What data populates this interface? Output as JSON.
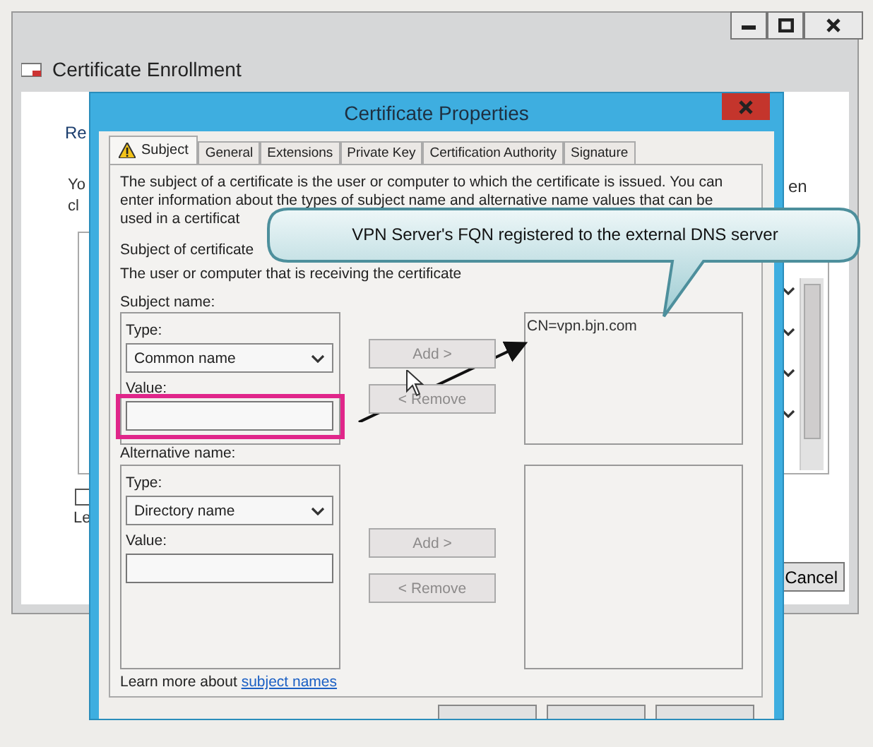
{
  "background_window": {
    "title": "Certificate Enrollment",
    "heading": "Re",
    "text_lines": [
      "Yo",
      "cl"
    ],
    "text_right": "en",
    "checkbox": {
      "label": "Le",
      "checked": false
    },
    "cancel_button": "Cancel"
  },
  "dialog": {
    "title": "Certificate Properties",
    "tabs": [
      {
        "label": "Subject",
        "selected": true,
        "warning": true
      },
      {
        "label": "General",
        "selected": false,
        "warning": false
      },
      {
        "label": "Extensions",
        "selected": false,
        "warning": false
      },
      {
        "label": "Private Key",
        "selected": false,
        "warning": false
      },
      {
        "label": "Certification Authority",
        "selected": false,
        "warning": false
      },
      {
        "label": "Signature",
        "selected": false,
        "warning": false
      }
    ],
    "description": "The subject of a certificate is the user or computer to which the certificate is issued. You can enter information about the types of subject name and alternative name values that can be used in a certificat",
    "section_title": "Subject of certificate",
    "section_hint": "The user or computer that is receiving the certificate",
    "groups": [
      {
        "label": "Subject name:",
        "type_label": "Type:",
        "type_value": "Common name",
        "value_label": "Value:",
        "highlighted": true,
        "add_button": {
          "label": "Add >",
          "disabled": true
        },
        "remove_button": {
          "label": "< Remove",
          "disabled": true
        },
        "entries": [
          "CN=vpn.bjn.com"
        ]
      },
      {
        "label": "Alternative name:",
        "type_label": "Type:",
        "type_value": "Directory name",
        "value_label": "Value:",
        "highlighted": false,
        "add_button": {
          "label": "Add >",
          "disabled": true
        },
        "remove_button": {
          "label": "< Remove",
          "disabled": true
        }
      }
    ],
    "learn_more": {
      "text": "Learn more about ",
      "link": "subject names"
    }
  },
  "callout": {
    "text": "VPN Server's FQN registered to the external DNS server"
  }
}
